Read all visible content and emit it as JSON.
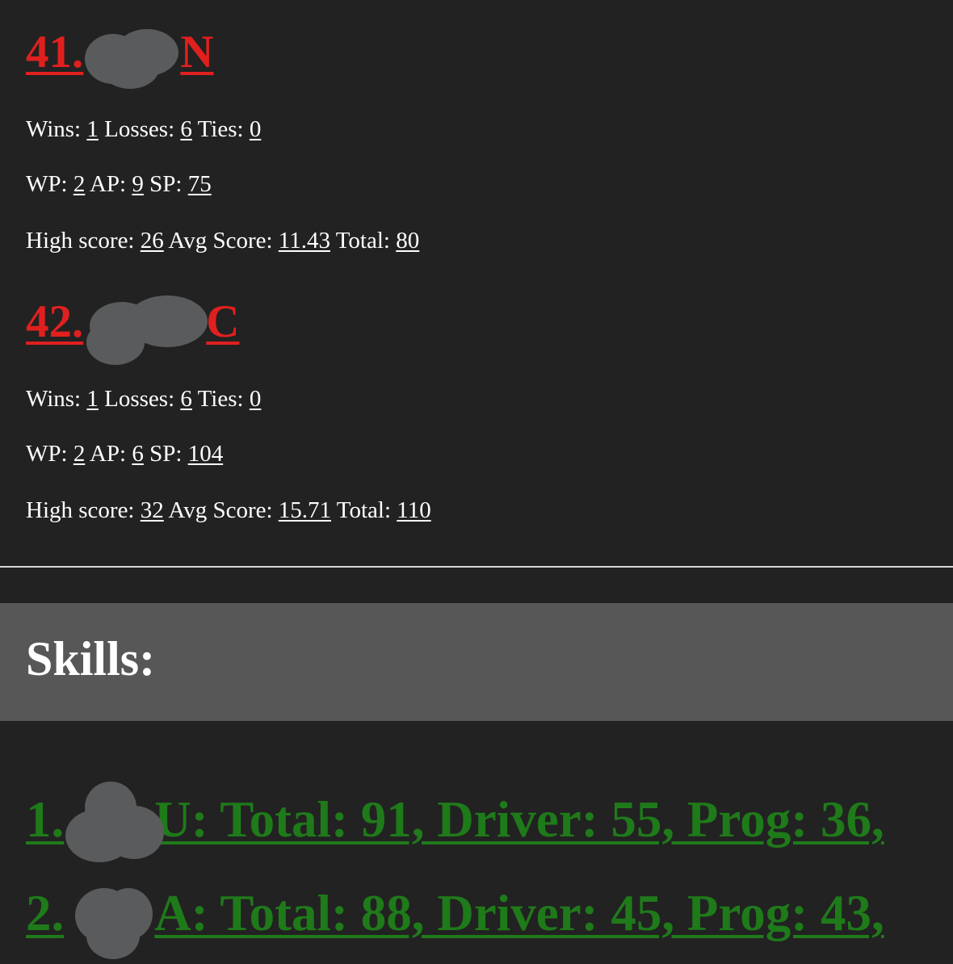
{
  "teams": [
    {
      "rank": "41.",
      "name_suffix": "N",
      "record": {
        "wins_label": "Wins:",
        "wins": "1",
        "losses_label": "Losses:",
        "losses": "6",
        "ties_label": "Ties:",
        "ties": "0"
      },
      "points": {
        "wp_label": "WP:",
        "wp": "2",
        "ap_label": "AP:",
        "ap": "9",
        "sp_label": "SP:",
        "sp": "75"
      },
      "scores": {
        "high_label": "High score:",
        "high": "26",
        "avg_label": "Avg Score:",
        "avg": "11.43",
        "total_label": "Total:",
        "total": "80"
      }
    },
    {
      "rank": "42.",
      "name_suffix": "C",
      "record": {
        "wins_label": "Wins:",
        "wins": "1",
        "losses_label": "Losses:",
        "losses": "6",
        "ties_label": "Ties:",
        "ties": "0"
      },
      "points": {
        "wp_label": "WP:",
        "wp": "2",
        "ap_label": "AP:",
        "ap": "6",
        "sp_label": "SP:",
        "sp": "104"
      },
      "scores": {
        "high_label": "High score:",
        "high": "32",
        "avg_label": "Avg Score:",
        "avg": "15.71",
        "total_label": "Total:",
        "total": "110"
      }
    }
  ],
  "skills": {
    "heading": "Skills:",
    "entries": [
      {
        "rank": "1.",
        "text": "U: Total: 91, Driver: 55, Prog: 36,"
      },
      {
        "rank": "2.",
        "text": "A: Total: 88, Driver: 45, Prog: 43,"
      }
    ]
  },
  "colors": {
    "background": "#222222",
    "team_link": "#e0201e",
    "skill_link": "#1f7a1a",
    "banner": "#575757",
    "redaction": "#5a5b5d"
  }
}
